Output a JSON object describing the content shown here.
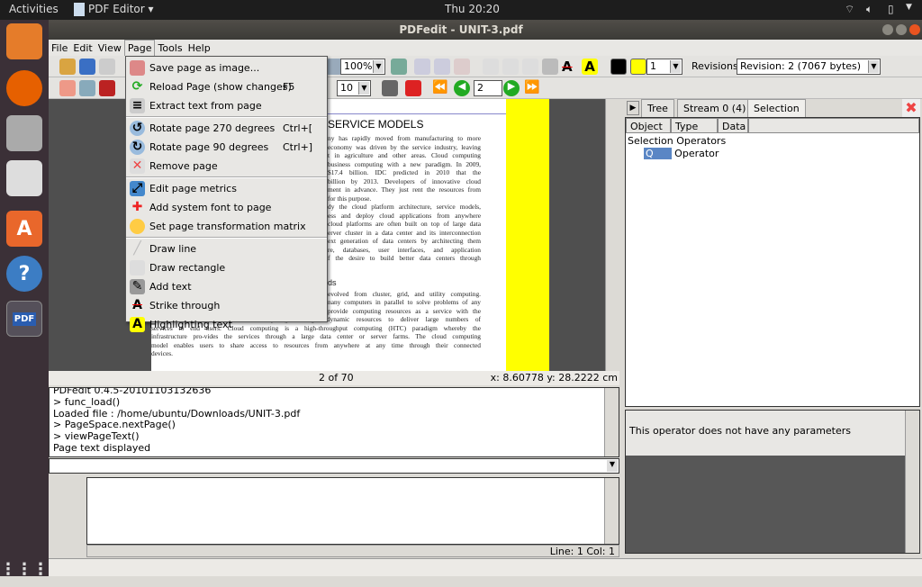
{
  "topbar": {
    "activities": "Activities",
    "app_menu": "PDF Editor ▾",
    "clock": "Thu 20:20"
  },
  "window": {
    "title": "PDFedit - UNIT-3.pdf"
  },
  "menubar": [
    "File",
    "Edit",
    "View",
    "Page",
    "Tools",
    "Help"
  ],
  "toolbar": {
    "zoom": "100%",
    "line_width": "1",
    "revisions_label": "Revisions",
    "revision": "Revision: 2 (7067 bytes)",
    "font_size": "10",
    "page_number": "2",
    "colors": {
      "stroke": "#000000",
      "fill": "#ffff00"
    }
  },
  "page_menu": [
    {
      "label": "Save page as image...",
      "shortcut": "",
      "icon": "image-icon"
    },
    {
      "label": "Reload Page (show changes)",
      "shortcut": "F5",
      "icon": "reload-icon"
    },
    {
      "label": "Extract text from page",
      "shortcut": "",
      "icon": "extract-text-icon"
    },
    {
      "label": "Rotate page 270 degrees",
      "shortcut": "Ctrl+[",
      "icon": "rotate-left-icon"
    },
    {
      "label": "Rotate page 90 degrees",
      "shortcut": "Ctrl+]",
      "icon": "rotate-right-icon"
    },
    {
      "label": "Remove page",
      "shortcut": "",
      "icon": "remove-page-icon"
    },
    {
      "label": "Edit page metrics",
      "shortcut": "",
      "icon": "page-metrics-icon"
    },
    {
      "label": "Add system font to page",
      "shortcut": "",
      "icon": "add-font-icon"
    },
    {
      "label": "Set page transformation matrix",
      "shortcut": "",
      "icon": "matrix-icon"
    },
    {
      "label": "Draw line",
      "shortcut": "",
      "icon": "line-icon"
    },
    {
      "label": "Draw rectangle",
      "shortcut": "",
      "icon": "rectangle-icon"
    },
    {
      "label": "Add text",
      "shortcut": "",
      "icon": "add-text-icon"
    },
    {
      "label": "Strike through",
      "shortcut": "",
      "icon": "strike-icon"
    },
    {
      "label": "Highlighting text",
      "shortcut": "",
      "icon": "highlight-icon"
    }
  ],
  "document": {
    "heading": "SERVICE MODELS",
    "para1": [
      "ny has rapidly moved from manufacturing to more",
      "economy was driven by the service industry, leaving",
      "t in agriculture and other areas. Cloud computing",
      "business computing with a new paradigm. In 2009,",
      "$17.4 billion. IDC predicted in 2010 that the",
      "billion by 2013. Developers of innovative cloud",
      "ment in advance. They just rent the resources from",
      "for this purpose.",
      "dy the cloud platform architecture, service models,",
      "ess and deploy cloud applications from anywhere",
      "cloud platforms are often built on top of large data",
      "erver cluster in a data center and its interconnection",
      "ext generation of data centers by architecting them",
      "re, databases, user interfaces, and application",
      "f the desire to build better data centers through"
    ],
    "subheading": "ds",
    "para2": [
      "evolved from cluster, grid, and utility computing.",
      "nany computers in parallel to solve problems of any",
      "provide computing resources as a service with the",
      "notion of pay per use. Cloud computing leverages dynamic resources to deliver large numbers of",
      "services to end users. Cloud computing is a high-throughput computing (HTC) paradigm whereby the",
      "infrastructure pro-vides the services through a large data center or server farms. The cloud computing",
      "model enables users to share access to resources from anywhere at any time through their connected",
      "devices."
    ]
  },
  "viewer_status": {
    "page": "2 of 70",
    "coords": "x: 8.60778 y: 28.2222 cm"
  },
  "console": [
    "PDFedit 0.4.5-20101103132636",
    "> func_load()",
    "Loaded file : /home/ubuntu/Downloads/UNIT-3.pdf",
    "> PageSpace.nextPage()",
    "> viewPageText()",
    "Page text displayed"
  ],
  "editor_status": "Line: 1 Col: 1",
  "right_panel": {
    "tabs": [
      "Tree",
      "Stream 0 (4)",
      "Selection"
    ],
    "columns": [
      "Object",
      "Type",
      "Data"
    ],
    "rows": [
      {
        "object": "Selection",
        "type": "Operators"
      },
      {
        "object": "Q",
        "type": "Operator"
      }
    ],
    "properties_message": "This operator does not have any parameters"
  }
}
